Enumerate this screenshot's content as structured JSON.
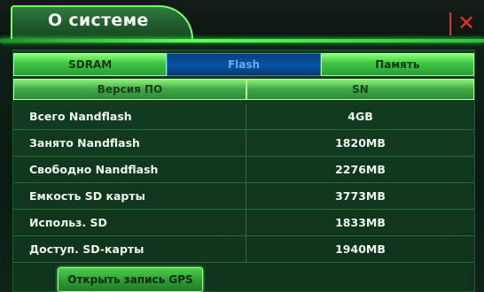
{
  "window": {
    "title": "О системе",
    "close_icon": "close-icon",
    "colors": {
      "accent_green": "#5dff5a",
      "active_tab_blue": "#0753a6",
      "close_red": "#ef2a2a"
    }
  },
  "tabs": [
    {
      "label": "SDRAM",
      "active": false
    },
    {
      "label": "Flash",
      "active": true
    },
    {
      "label": "Память",
      "active": false
    }
  ],
  "table": {
    "headers": [
      "Версия ПО",
      "SN"
    ],
    "rows": [
      {
        "label": "Всего Nandflash",
        "value": "4GB"
      },
      {
        "label": "Занято Nandflash",
        "value": "1820MB"
      },
      {
        "label": "Свободно Nandflash",
        "value": "2276MB"
      },
      {
        "label": "Емкость SD карты",
        "value": "3773MB"
      },
      {
        "label": "Использ. SD",
        "value": "1833MB"
      },
      {
        "label": "Доступ. SD-карты",
        "value": "1940MB"
      }
    ]
  },
  "footer": {
    "gps_button_label": "Открыть запись GPS"
  }
}
